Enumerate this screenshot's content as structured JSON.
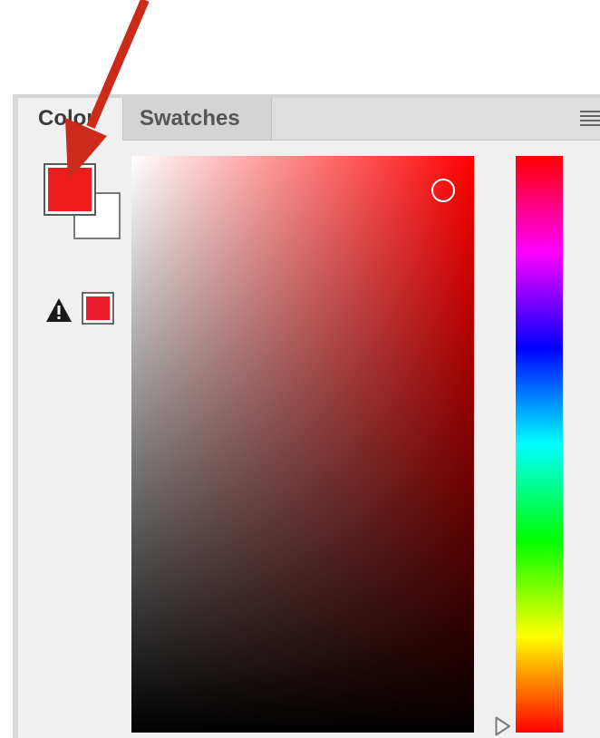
{
  "tabs": [
    {
      "label": "Color",
      "active": true
    },
    {
      "label": "Swatches",
      "active": false
    }
  ],
  "colors": {
    "fill": "#ee1c1c",
    "stroke": "#ffffff",
    "gamut_warning_swatch": "#e81c2a",
    "hue_base": "#ff0000",
    "annotation_arrow": "#cc2a1a"
  },
  "picker": {
    "saturation_fraction": 0.91,
    "brightness_fraction": 0.94,
    "hue_degrees": 0
  },
  "icons": {
    "panel_menu": "hamburger-menu-icon",
    "gamut_warning": "warning-triangle-icon",
    "hue_handle": "triangle-right-icon"
  }
}
